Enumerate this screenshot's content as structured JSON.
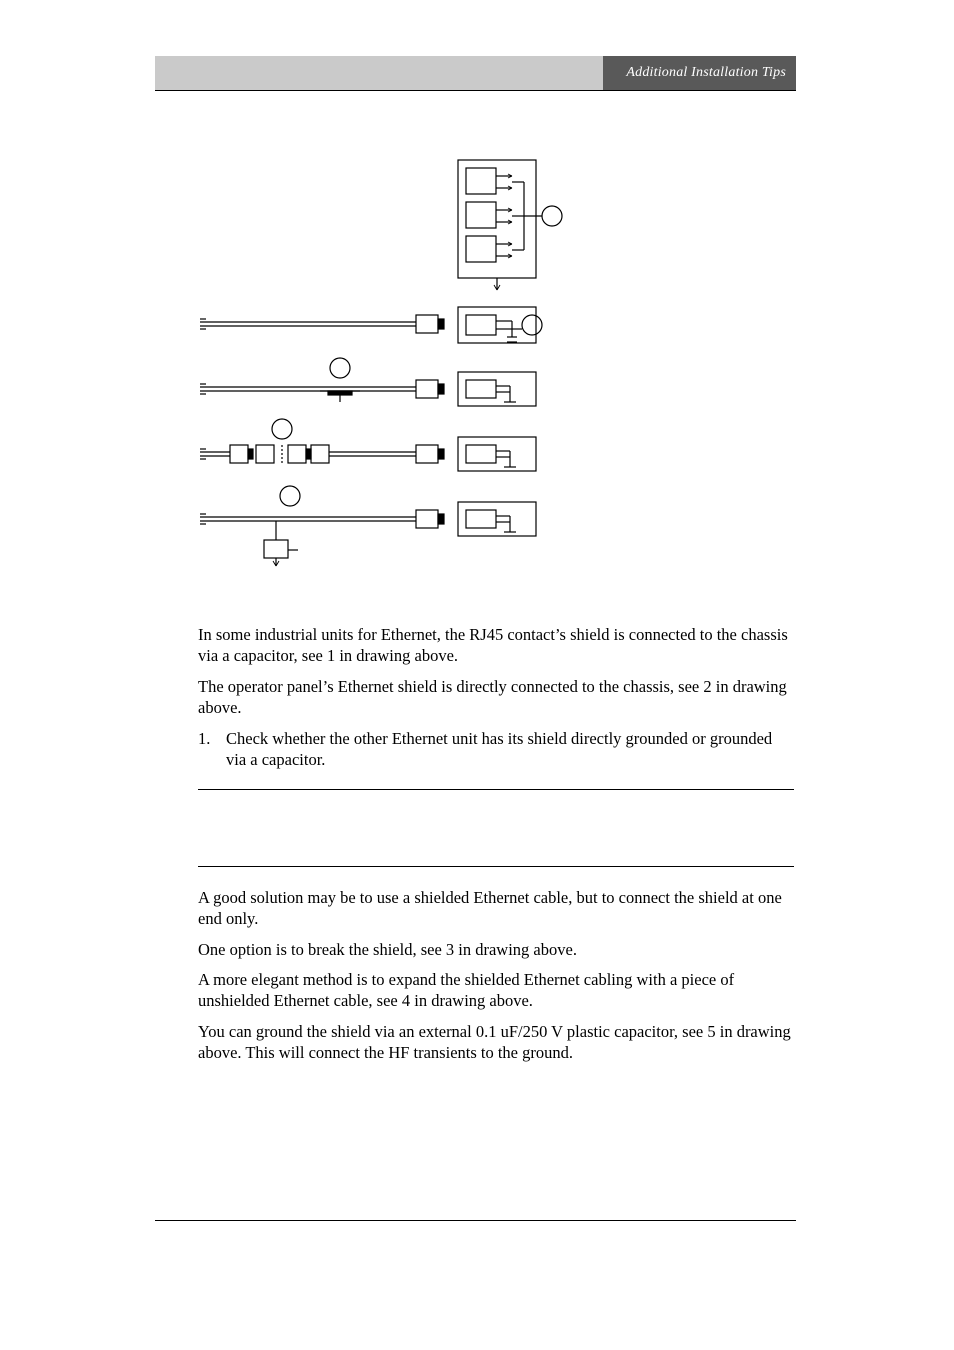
{
  "header": {
    "title": "Additional Installation Tips"
  },
  "body": {
    "p1": "In some industrial units for Ethernet, the RJ45 contact’s shield is connected to the chassis via a capacitor, see 1 in drawing above.",
    "p2": "The operator panel’s Ethernet shield is directly connected to the chassis, see 2 in drawing above.",
    "ol1_num": "1.",
    "ol1_text": "Check whether the other Ethernet unit has its shield directly grounded or grounded via a capacitor.",
    "p3": "A good solution may be to use a shielded Ethernet cable, but to connect the shield at one end only.",
    "p4": "One option is to break the shield, see 3 in drawing above.",
    "p5": "A more elegant method is to expand the shielded Ethernet cabling with a piece of unshielded Ethernet cable, see 4 in drawing above.",
    "p6": "You can ground the shield via an external 0.1 uF/250 V plastic capacitor, see 5 in drawing above.  This will connect the HF transients to the ground."
  }
}
